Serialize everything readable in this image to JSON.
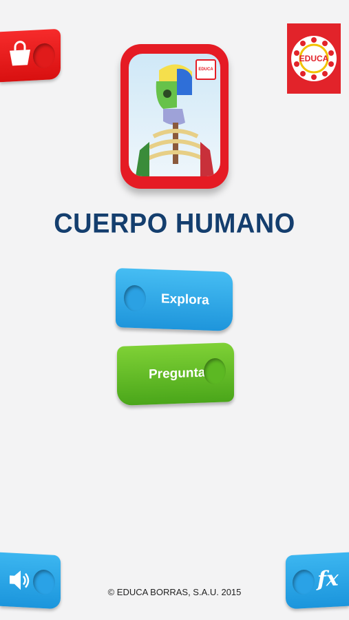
{
  "header": {
    "shop_icon": "shopping-bag-icon",
    "logo_text": "EDUCA"
  },
  "app": {
    "icon": "skeleton-app-icon",
    "icon_logo_text": "EDUCA",
    "title": "CUERPO HUMANO"
  },
  "menu": {
    "explora_label": "Explora",
    "preguntas_label": "Preguntas"
  },
  "footer": {
    "sound_icon": "speaker-icon",
    "fx_label": "fx",
    "copyright": "© EDUCA BORRAS, S.A.U. 2015"
  },
  "colors": {
    "background": "#f3f3f4",
    "red": "#e51b24",
    "blue": "#1e95db",
    "green": "#4aa61a",
    "title": "#143e6e"
  }
}
